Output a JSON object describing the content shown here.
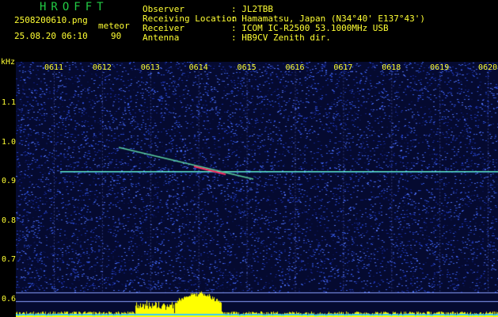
{
  "app_title": "HROFFT",
  "file": "2508200610.png",
  "mode_label": "meteor",
  "datetime": "25.08.20 06:10",
  "count": "90",
  "info": [
    {
      "label": "Observer",
      "value": ": JL2TBB"
    },
    {
      "label": "Receiving Location",
      "value": ": Hamamatsu, Japan (N34°40' E137°43')"
    },
    {
      "label": "Receiver",
      "value": ": ICOM IC-R2500 53.1000MHz USB"
    },
    {
      "label": "Antenna",
      "value": ": HB9CV Zenith dir."
    }
  ],
  "unit": "kHz",
  "time_labels": [
    "0611",
    "0612",
    "0613",
    "0614",
    "0615",
    "0616",
    "0617",
    "0618",
    "0619",
    "0620"
  ],
  "freq_labels": [
    "1.1",
    "1.0",
    "0.9",
    "0.8",
    "0.7",
    "0.6"
  ],
  "colors": {
    "background": "#000000",
    "label": "#ffff33",
    "title": "#22cc44",
    "noise": "#1a2a8a",
    "carrier": "#66ffcc",
    "meteor": "#ff3366",
    "level": "#ffff00"
  }
}
